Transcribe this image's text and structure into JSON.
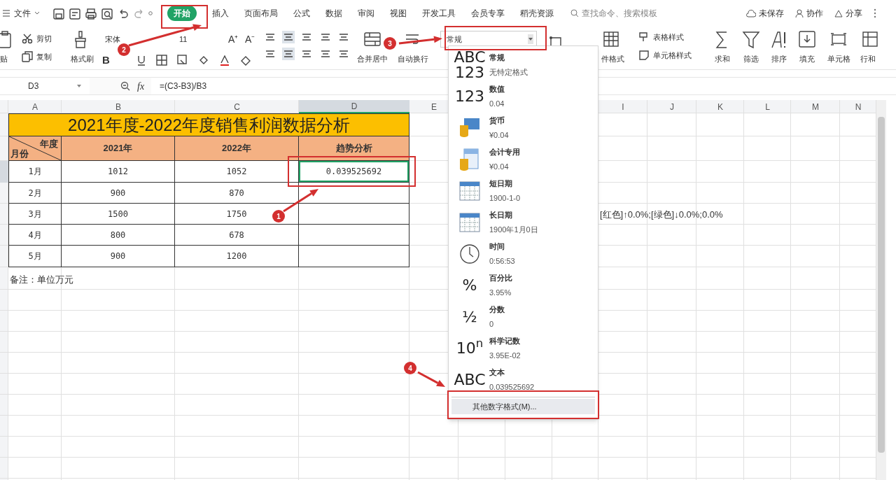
{
  "menu": {
    "file": "文件"
  },
  "tabs": [
    {
      "label": "开始",
      "selected": true
    },
    {
      "label": "插入",
      "selected": false
    },
    {
      "label": "页面布局",
      "selected": false
    },
    {
      "label": "公式",
      "selected": false
    },
    {
      "label": "数据",
      "selected": false
    },
    {
      "label": "审阅",
      "selected": false
    },
    {
      "label": "视图",
      "selected": false
    },
    {
      "label": "开发工具",
      "selected": false
    },
    {
      "label": "会员专享",
      "selected": false
    },
    {
      "label": "稻壳资源",
      "selected": false
    }
  ],
  "search": {
    "placeholder": "查找命令、搜索模板"
  },
  "top_actions": {
    "save": "未保存",
    "collab": "协作",
    "share": "分享"
  },
  "ribbon": {
    "paste": "贴",
    "cut": "剪切",
    "copy": "复制",
    "format_painter": "格式刷",
    "font": "宋体",
    "font_size": "11",
    "bold": "B",
    "grow": "A⁺",
    "shrink": "A⁻",
    "merge": "合并居中",
    "wrap": "自动换行",
    "number_format": "常规",
    "cond_format": "件格式",
    "table_style": "表格样式",
    "cell_style": "单元格样式",
    "sum": "求和",
    "filter": "筛选",
    "sort": "排序",
    "fill": "填充",
    "cell": "单元格",
    "row_col": "行和"
  },
  "formula_bar": {
    "name_box": "D3",
    "fx": "fx",
    "formula": "=(C3-B3)/B3"
  },
  "sheet": {
    "columns": [
      {
        "label": "A",
        "selected": false
      },
      {
        "label": "B",
        "selected": false
      },
      {
        "label": "C",
        "selected": false
      },
      {
        "label": "D",
        "selected": true
      },
      {
        "label": "E",
        "selected": false
      },
      {
        "label": "I",
        "selected": false
      },
      {
        "label": "J",
        "selected": false
      },
      {
        "label": "K",
        "selected": false
      },
      {
        "label": "L",
        "selected": false
      },
      {
        "label": "M",
        "selected": false
      },
      {
        "label": "N",
        "selected": false
      }
    ],
    "title": "2021年度-2022年度销售利润数据分析",
    "corner_top": "年度",
    "corner_bottom": "月份",
    "headers": [
      "2021年",
      "2022年",
      "趋势分析"
    ],
    "rows": [
      {
        "month": "1月",
        "y2021": "1012",
        "y2022": "1052",
        "trend": "0.039525692",
        "selected": true
      },
      {
        "month": "2月",
        "y2021": "900",
        "y2022": "870",
        "selected": false
      },
      {
        "month": "3月",
        "y2021": "1500",
        "y2022": "1750",
        "selected": false,
        "column_i": "[红色]↑0.0%;[绿色]↓0.0%;0.0%"
      },
      {
        "month": "4月",
        "y2021": "800",
        "y2022": "678",
        "selected": false
      },
      {
        "month": "5月",
        "y2021": "900",
        "y2022": "1200",
        "selected": false
      }
    ],
    "note": "备注：单位万元"
  },
  "format_menu": {
    "items": [
      {
        "kind": "glyph",
        "glyph": "ABC\n123",
        "name": "常规",
        "sample": "无特定格式"
      },
      {
        "kind": "glyph",
        "glyph": "123",
        "name": "数值",
        "sample": "0.04"
      },
      {
        "kind": "currency",
        "name": "货币",
        "sample": "¥0.04"
      },
      {
        "kind": "accounting",
        "name": "会计专用",
        "sample": "¥0.04"
      },
      {
        "kind": "calendar",
        "name": "短日期",
        "sample": "1900-1-0"
      },
      {
        "kind": "calendar",
        "name": "长日期",
        "sample": "1900年1月0日"
      },
      {
        "kind": "clock",
        "name": "时间",
        "sample": "0:56:53"
      },
      {
        "kind": "glyph",
        "glyph": "%",
        "name": "百分比",
        "sample": "3.95%"
      },
      {
        "kind": "glyph",
        "glyph": "½",
        "name": "分数",
        "sample": "0"
      },
      {
        "kind": "glyph",
        "glyph": "10$^{n}$",
        "name": "科学记数",
        "sample": "3.95E-02"
      },
      {
        "kind": "glyph",
        "glyph": "ABC",
        "name": "文本",
        "sample": "0.039525692"
      }
    ],
    "more": "其他数字格式(M)..."
  },
  "steps": [
    "1",
    "2",
    "3",
    "4"
  ]
}
